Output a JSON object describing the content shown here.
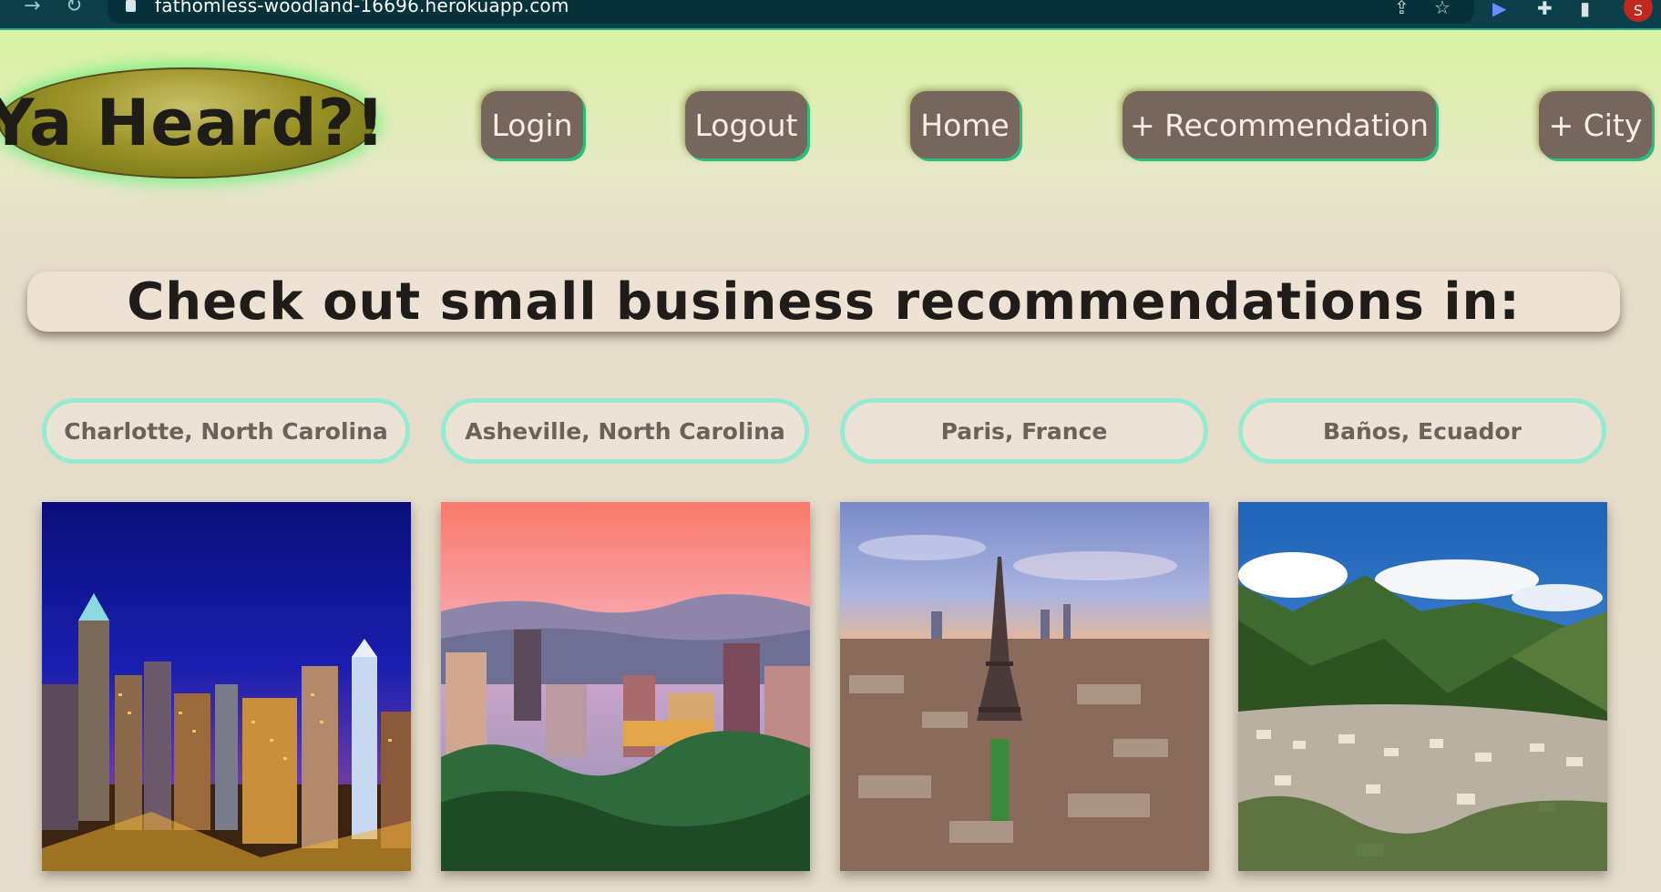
{
  "browser": {
    "url": "fathomless-woodland-16696.herokuapp.com",
    "profile_initial": "S",
    "icons": [
      "forward-icon",
      "reload-icon",
      "lock-icon",
      "share-icon",
      "star-icon",
      "extension-icon",
      "puzzle-icon",
      "sidepanel-icon"
    ]
  },
  "header": {
    "logo": "Ya Heard?!",
    "nav": {
      "login": "Login",
      "logout": "Logout",
      "home": "Home",
      "add_recommendation": "+ Recommendation",
      "add_city": "+ City"
    }
  },
  "main": {
    "heading": "Check out small business recommendations in:",
    "cities": [
      {
        "name": "Charlotte, North Carolina"
      },
      {
        "name": "Asheville, North Carolina"
      },
      {
        "name": "Paris, France"
      },
      {
        "name": "Baños, Ecuador"
      }
    ]
  },
  "colors": {
    "accent_green": "#29bf7f",
    "pill_border": "#97ead2",
    "button_bg": "#76665b",
    "chrome_bg": "#0b3f4a"
  }
}
